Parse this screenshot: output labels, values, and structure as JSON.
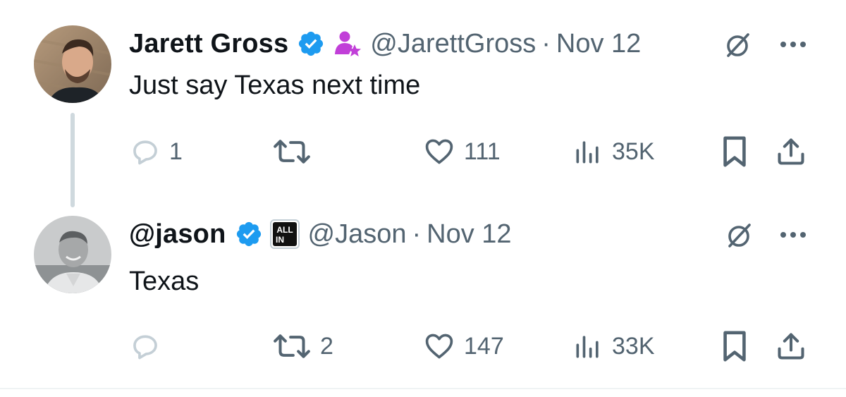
{
  "tweets": [
    {
      "author_name": "Jarett Gross",
      "handle": "@JarettGross",
      "separator": "·",
      "date": "Nov 12",
      "text": "Just say Texas next time",
      "replies": "1",
      "reposts": "",
      "likes": "111",
      "views": "35K",
      "avatar_icon": "user-avatar-photo",
      "affiliation_icon": "person-star-icon"
    },
    {
      "author_name": "@jason",
      "handle": "@Jason",
      "separator": "·",
      "date": "Nov 12",
      "text": "Texas",
      "replies": "",
      "reposts": "2",
      "likes": "147",
      "views": "33K",
      "avatar_icon": "user-avatar-photo",
      "affiliation_badge": "ALL IN"
    }
  ],
  "colors": {
    "verified": "#1d9bf0",
    "affiliation_purple": "#c13fd8",
    "icon_gray": "#536471",
    "thread_line": "#cfd9de"
  }
}
